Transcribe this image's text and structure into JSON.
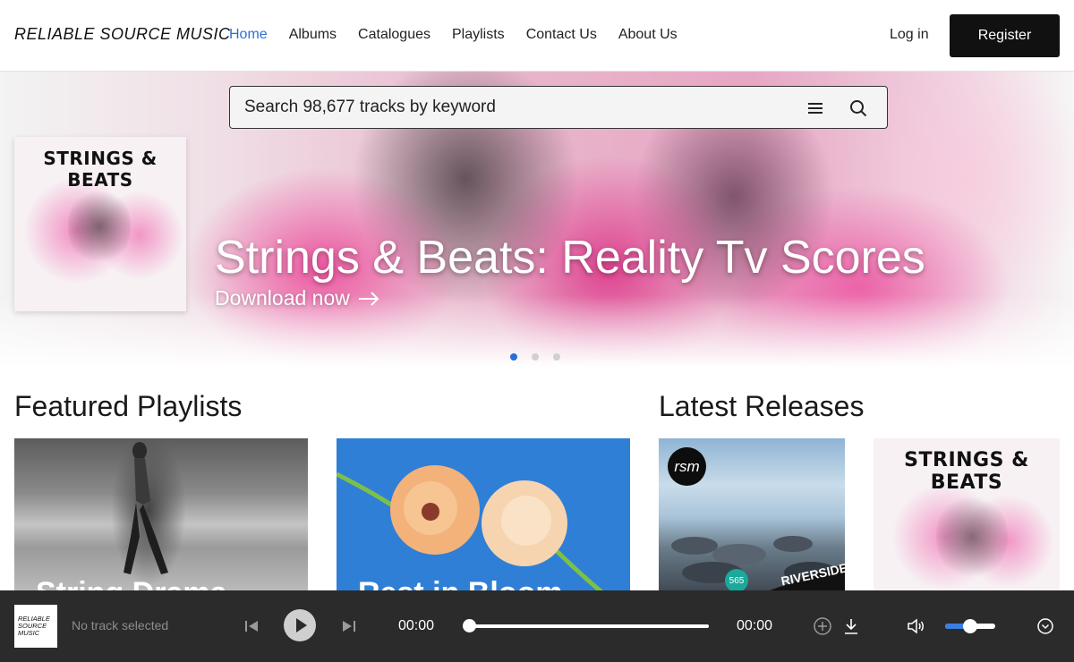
{
  "header": {
    "logo_text": "RELIABLE SOURCE MUSIC",
    "nav": [
      {
        "label": "Home",
        "active": true
      },
      {
        "label": "Albums"
      },
      {
        "label": "Catalogues"
      },
      {
        "label": "Playlists"
      },
      {
        "label": "Contact Us"
      },
      {
        "label": "About Us"
      }
    ],
    "login_label": "Log in",
    "register_label": "Register"
  },
  "search": {
    "placeholder": "Search 98,677 tracks by keyword"
  },
  "hero": {
    "album_cover_title": "STRINGS & BEATS",
    "title": "Strings & Beats: Reality Tv Scores",
    "cta": "Download now",
    "slide_count": 3,
    "active_slide": 1
  },
  "sections": {
    "featured_title": "Featured Playlists",
    "latest_title": "Latest Releases"
  },
  "featured_playlists": [
    {
      "label": "String Drama"
    },
    {
      "label": "Rest in Bloom"
    }
  ],
  "latest_releases": [
    {
      "badge": "rsm",
      "number": "565",
      "label": "RIVERSIDE"
    },
    {
      "cover_title": "STRINGS & BEATS"
    }
  ],
  "player": {
    "logo_text": "RELIABLE SOURCE MUSIC",
    "track": "No track selected",
    "current_time": "00:00",
    "duration": "00:00",
    "progress": 0,
    "volume": 0.5
  },
  "colors": {
    "accent": "#2a6fd6",
    "register_bg": "#111111",
    "player_bg": "#2b2b2b",
    "volume_fill": "#3a7ee0"
  }
}
